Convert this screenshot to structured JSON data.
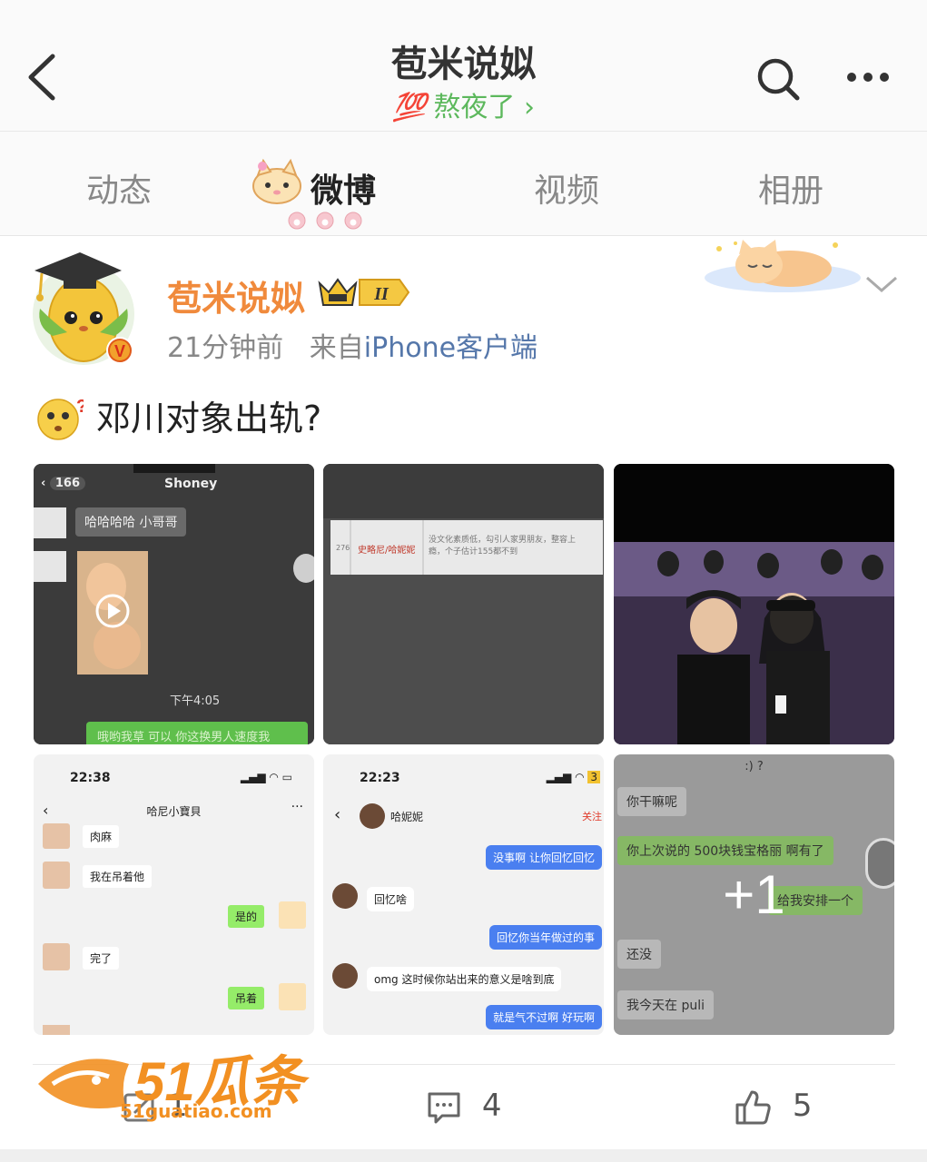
{
  "header": {
    "title": "苞米说姒",
    "badge_text": "💯",
    "subtitle": "熬夜了",
    "subtitle_arrow": "›"
  },
  "tabs": [
    {
      "label": "动态",
      "active": false
    },
    {
      "label": "微博",
      "active": true
    },
    {
      "label": "视频",
      "active": false
    },
    {
      "label": "相册",
      "active": false
    }
  ],
  "post": {
    "author": "苞米说姒",
    "crown_level": "II",
    "time": "21分钟前",
    "source_prefix": "来自",
    "source": "iPhone客户端",
    "text": "邓川对象出轨?",
    "images": {
      "img1": {
        "back_count": "166",
        "contact": "Shoney",
        "bubble1": "哈哈哈哈 小哥哥",
        "time": "下午4:05",
        "bubble2": "哦哟我草 可以 你这换男人速度我"
      },
      "img2": {
        "row_id": "276",
        "name": "史略尼/哈妮妮",
        "desc": "没文化素质低，勾引人家男朋友，整容上瘾，个子估计155都不到"
      },
      "img4": {
        "status_time": "22:38",
        "chat_title": "哈尼小寶貝",
        "messages": [
          "肉麻",
          "我在吊着他",
          "是的",
          "完了",
          "吊着"
        ]
      },
      "img5": {
        "status_time": "22:23",
        "contact": "哈妮妮",
        "follow": "关注",
        "messages": [
          "没事啊 让你回忆回忆",
          "回忆啥",
          "回忆你当年做过的事",
          "omg 这时候你站出来的意义是啥到底",
          "就是气不过啊 好玩啊"
        ]
      },
      "img6": {
        "top": ":) ?",
        "messages": [
          "你干嘛呢",
          "你上次说的 500块钱宝格丽 啊有了",
          "给我安排一个",
          "还没",
          "我今天在 puli"
        ],
        "more_count": "+1"
      }
    }
  },
  "footer": {
    "repost_count": "1",
    "comment_count": "4",
    "like_count": "5"
  },
  "watermark": {
    "brand": "51瓜条",
    "url": "51guatiao.com"
  },
  "colors": {
    "accent_green": "#5cb85c",
    "author_orange": "#f08a3c",
    "source_blue": "#5577aa",
    "wechat_green": "#95ec69",
    "bubble_blue": "#4a7ff0"
  }
}
